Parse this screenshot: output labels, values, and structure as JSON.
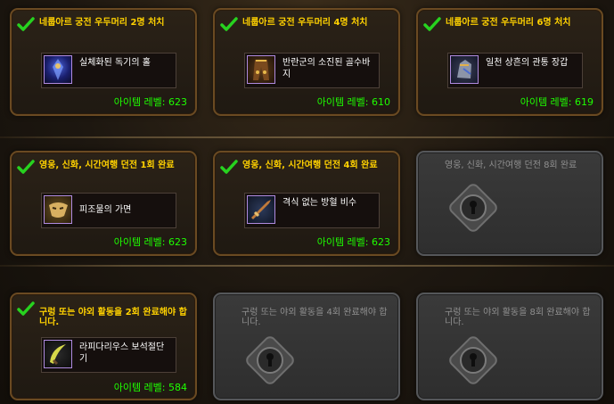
{
  "cards": [
    {
      "requirement": "네룹아르 궁전 우두머리 2명 처치",
      "item_name": "실체화된 독기의 홀",
      "item_level": "아이템 레벨: 623",
      "icon": "staff-icon"
    },
    {
      "requirement": "네룹아르 궁전 우두머리 4명 처치",
      "item_name": "반란군의 소진된 골수바지",
      "item_level": "아이템 레벨: 610",
      "icon": "pants-icon"
    },
    {
      "requirement": "네룹아르 궁전 우두머리 6명 처치",
      "item_name": "일천 상흔의 관통 장갑",
      "item_level": "아이템 레벨: 619",
      "icon": "gauntlet-icon"
    },
    {
      "requirement": "영웅, 신화, 시간여행 던전 1회 완료",
      "item_name": "피조물의 가면",
      "item_level": "아이템 레벨: 623",
      "icon": "mask-icon"
    },
    {
      "requirement": "영웅, 신화, 시간여행 던전 4회 완료",
      "item_name": "격식 없는 방혈 비수",
      "item_level": "아이템 레벨: 623",
      "icon": "dagger-icon"
    },
    {
      "requirement": "영웅, 신화, 시간여행 던전 8회 완료"
    },
    {
      "requirement": "구렁 또는 야외 활동을 2회 완료해야 합니다.",
      "item_name": "라피다리우스 보석절단기",
      "item_level": "아이템 레벨: 584",
      "icon": "blade-icon"
    },
    {
      "requirement": "구렁 또는 야외 활동을 4회 완료해야 합니다."
    },
    {
      "requirement": "구렁 또는 야외 활동을 8회 완료해야 합니다."
    }
  ],
  "colors": {
    "requirement_text": "#ffd100",
    "item_level_text": "#1eff00",
    "epic_border": "#b08be0",
    "check": "#27d21f"
  }
}
